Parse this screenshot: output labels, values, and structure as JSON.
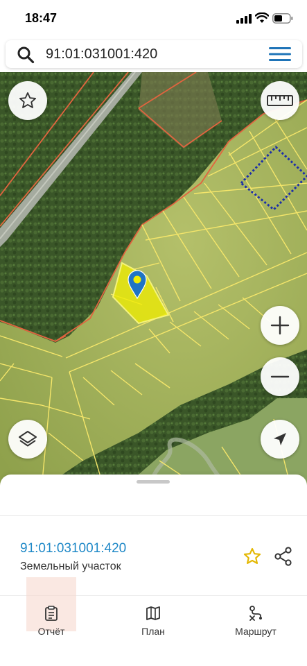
{
  "status": {
    "time": "18:47"
  },
  "search": {
    "query": "91:01:031001:420"
  },
  "map": {
    "colors": {
      "forest": "#3d5a2b",
      "field": "#9cae59",
      "boundary": "#f5e66a",
      "selected_parcel": "#f0ee00",
      "adjacent_boundary": "#e2643f",
      "dotted_boundary": "#1d2fa8",
      "road": "#9aa39a",
      "marker": "#1f74c4"
    },
    "buttons": [
      "favorite",
      "ruler",
      "zoom-in",
      "zoom-out",
      "layers",
      "my-location"
    ]
  },
  "parcel": {
    "number": "91:01:031001:420",
    "type": "Земельный участок"
  },
  "tabs": [
    {
      "label": "Отчёт",
      "icon": "clipboard-icon"
    },
    {
      "label": "План",
      "icon": "map-icon"
    },
    {
      "label": "Маршрут",
      "icon": "route-icon"
    }
  ]
}
